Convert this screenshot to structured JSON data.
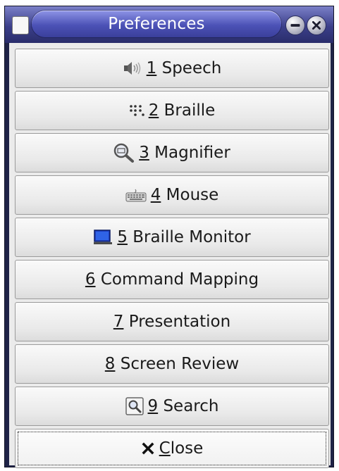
{
  "window": {
    "title": "Preferences"
  },
  "buttons": [
    {
      "mnemonic": "1",
      "label": "Speech",
      "icon": "speaker-icon"
    },
    {
      "mnemonic": "2",
      "label": "Braille",
      "icon": "braille-icon"
    },
    {
      "mnemonic": "3",
      "label": "Magnifier",
      "icon": "magnifier-icon"
    },
    {
      "mnemonic": "4",
      "label": "Mouse",
      "icon": "keyboard-icon"
    },
    {
      "mnemonic": "5",
      "label": "Braille Monitor",
      "icon": "monitor-icon"
    },
    {
      "mnemonic": "6",
      "label": "Command Mapping",
      "icon": null
    },
    {
      "mnemonic": "7",
      "label": "Presentation",
      "icon": null
    },
    {
      "mnemonic": "8",
      "label": "Screen Review",
      "icon": null
    },
    {
      "mnemonic": "9",
      "label": "Search",
      "icon": "search-icon"
    }
  ],
  "close_button": {
    "mnemonic": "C",
    "label_rest": "lose",
    "icon": "close-x-icon"
  },
  "colors": {
    "titlebar": "#3b3f8a",
    "title_pill": "#4c52b6",
    "button_face": "#ededed",
    "content_bg": "#ebebeb"
  }
}
